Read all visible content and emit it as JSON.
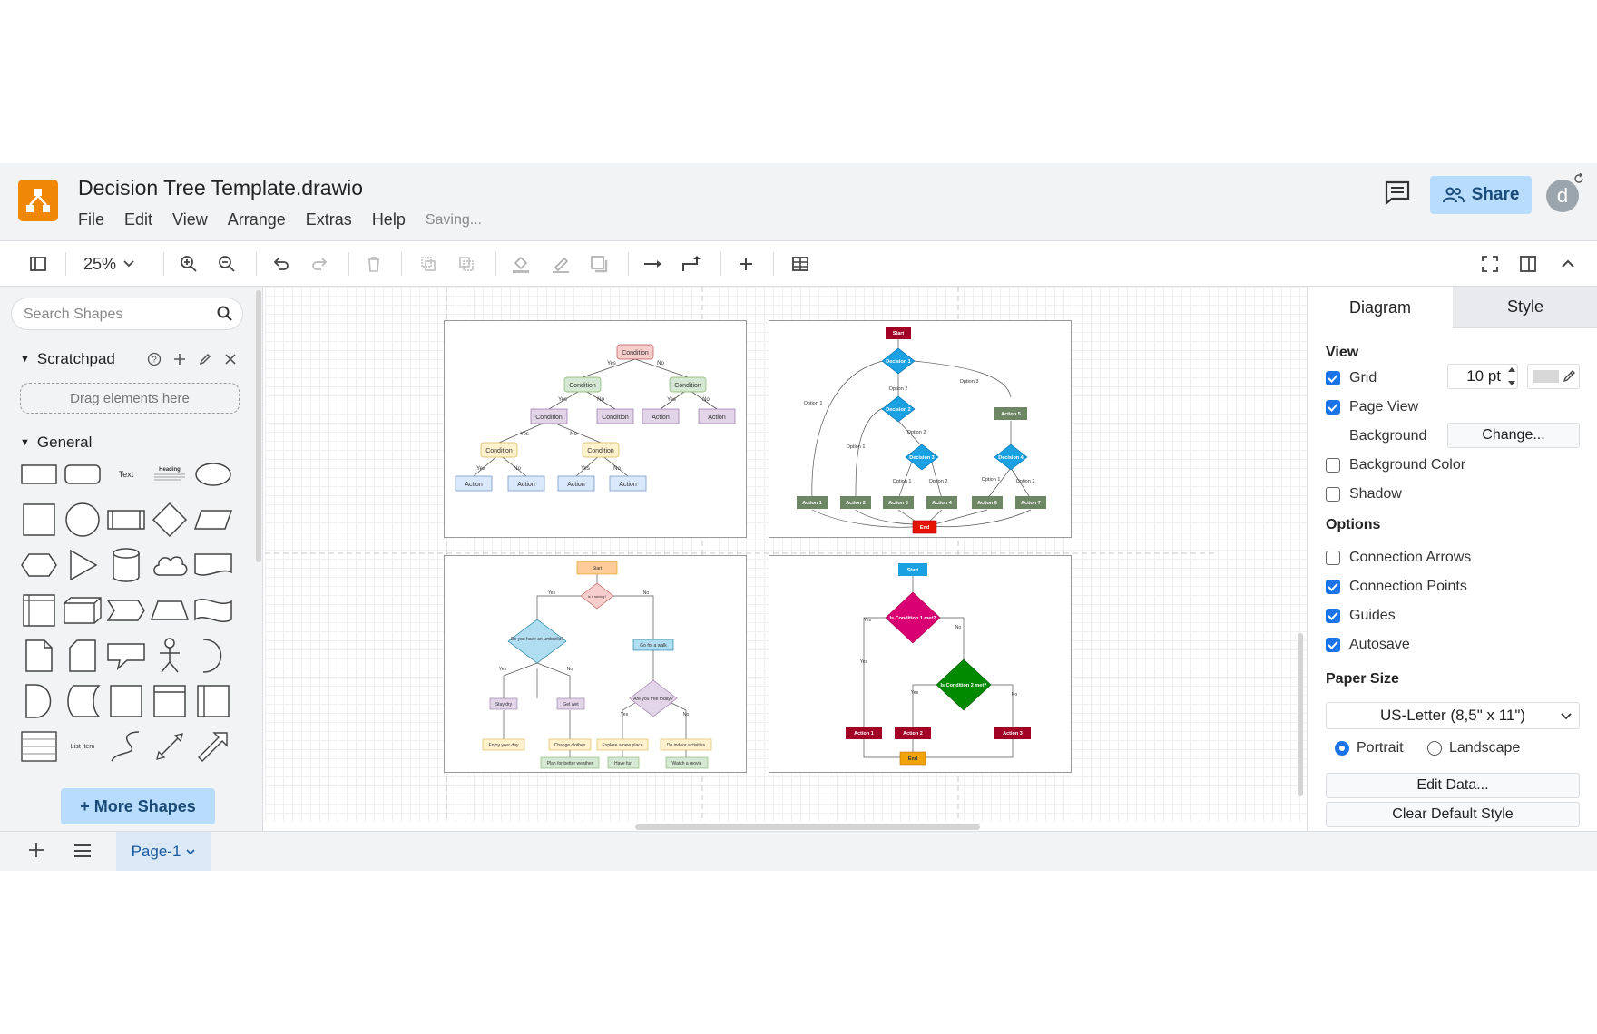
{
  "header": {
    "title": "Decision Tree Template.drawio",
    "menu": [
      "File",
      "Edit",
      "View",
      "Arrange",
      "Extras",
      "Help"
    ],
    "status": "Saving...",
    "share_label": "Share",
    "avatar_initial": "d"
  },
  "toolbar": {
    "zoom": "25%"
  },
  "sidebar": {
    "search_placeholder": "Search Shapes",
    "scratchpad_label": "Scratchpad",
    "drop_hint": "Drag elements here",
    "general_label": "General",
    "shape_text": "Text",
    "shape_heading": "Heading",
    "shape_list_item": "List Item",
    "more_shapes_label": "+ More Shapes"
  },
  "canvas": {
    "tree1": {
      "root": "Condition",
      "l2": [
        "Condition",
        "Condition"
      ],
      "l3": [
        "Condition",
        "Condition",
        "Action",
        "Action"
      ],
      "l4": [
        "Condition",
        "Condition"
      ],
      "l5": [
        "Action",
        "Action",
        "Action",
        "Action"
      ],
      "yes": "Yes",
      "no": "No"
    },
    "tree2": {
      "start": "Start",
      "d1": "Decision 1",
      "d2": "Decision 2",
      "d3": "Decision 3",
      "d4": "Decision 4",
      "a5": "Action 5",
      "actions": [
        "Action 1",
        "Action 2",
        "Action 3",
        "Action 4",
        "Action 6",
        "Action 7"
      ],
      "end": "End",
      "opts": [
        "Option 1",
        "Option 2",
        "Option 3",
        "Option 1",
        "Option 2",
        "Option 1",
        "Option 2",
        "Option 1",
        "Option 2"
      ]
    },
    "tree3": {
      "start": "Start",
      "q1": "Is it raining?",
      "q2": "Do you have an umbrella?",
      "walk": "Go for a walk",
      "q3": "Are you free today?",
      "stay": "Stay dry",
      "wet": "Get wet",
      "enjoy": "Enjoy your day",
      "change": "Change clothes",
      "explore": "Explore a new place",
      "indoor": "Do indoor activities",
      "plan": "Plan for better weather",
      "fun": "Have fun",
      "movie": "Watch a movie",
      "yes": "Yes",
      "no": "No"
    },
    "tree4": {
      "start": "Start",
      "q1": "Is Condition 1 met?",
      "q2": "Is Condition 2 met?",
      "a1": "Action 1",
      "a2": "Action 2",
      "a3": "Action 3",
      "end": "End",
      "yes": "Yes",
      "no": "No"
    }
  },
  "panel": {
    "tab_diagram": "Diagram",
    "tab_style": "Style",
    "view_head": "View",
    "grid": "Grid",
    "grid_size": "10 pt",
    "page_view": "Page View",
    "background": "Background",
    "change": "Change...",
    "bg_color": "Background Color",
    "shadow": "Shadow",
    "options_head": "Options",
    "conn_arrows": "Connection Arrows",
    "conn_points": "Connection Points",
    "guides": "Guides",
    "autosave": "Autosave",
    "paper_head": "Paper Size",
    "paper_size": "US-Letter (8,5\" x 11\")",
    "portrait": "Portrait",
    "landscape": "Landscape",
    "edit_data": "Edit Data...",
    "clear_style": "Clear Default Style"
  },
  "footer": {
    "page_tab": "Page-1"
  },
  "colors": {
    "accent": "#1a73e8",
    "share_bg": "#b8dcfb",
    "logo": "#f08705"
  }
}
